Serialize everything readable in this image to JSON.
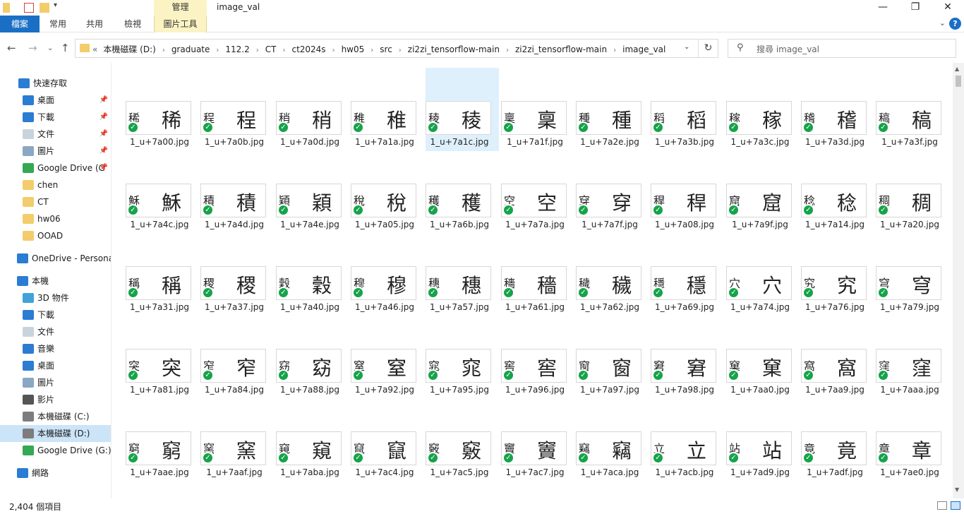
{
  "titlebar": {
    "manage_label": "管理",
    "window_title": "image_val",
    "minimize_icon": "minimize-icon",
    "restore_icon": "restore-icon",
    "close_icon": "close-icon"
  },
  "ribbon": {
    "tabs": [
      "檔案",
      "常用",
      "共用",
      "檢視",
      "圖片工具"
    ],
    "help_label": "?"
  },
  "address": {
    "crumbs": [
      "本機磁碟 (D:)",
      "graduate",
      "112.2",
      "CT",
      "ct2024s",
      "hw05",
      "src",
      "zi2zi_tensorflow-main",
      "zi2zi_tensorflow-main",
      "image_val"
    ]
  },
  "search": {
    "placeholder": "搜尋 image_val"
  },
  "sidebar": {
    "items": [
      {
        "label": "快速存取",
        "icon": "star-icon"
      },
      {
        "label": "桌面",
        "icon": "desktop-icon",
        "pinned": true
      },
      {
        "label": "下載",
        "icon": "download-icon",
        "pinned": true
      },
      {
        "label": "文件",
        "icon": "document-icon",
        "pinned": true
      },
      {
        "label": "圖片",
        "icon": "picture-icon",
        "pinned": true
      },
      {
        "label": "Google Drive (G",
        "icon": "google-drive-icon",
        "pinned": true
      },
      {
        "label": "chen",
        "icon": "folder-icon"
      },
      {
        "label": "CT",
        "icon": "folder-icon"
      },
      {
        "label": "hw06",
        "icon": "folder-icon"
      },
      {
        "label": "OOAD",
        "icon": "folder-icon"
      },
      {
        "label": "OneDrive - Personal",
        "icon": "onedrive-icon"
      },
      {
        "label": "本機",
        "icon": "computer-icon"
      },
      {
        "label": "3D 物件",
        "icon": "cube-icon"
      },
      {
        "label": "下載",
        "icon": "download-icon"
      },
      {
        "label": "文件",
        "icon": "document-icon"
      },
      {
        "label": "音樂",
        "icon": "music-icon"
      },
      {
        "label": "桌面",
        "icon": "desktop-icon"
      },
      {
        "label": "圖片",
        "icon": "picture-icon"
      },
      {
        "label": "影片",
        "icon": "video-icon"
      },
      {
        "label": "本機磁碟 (C:)",
        "icon": "drive-icon"
      },
      {
        "label": "本機磁碟 (D:)",
        "icon": "drive-icon",
        "selected": true
      },
      {
        "label": "Google Drive (G:)",
        "icon": "google-drive-icon"
      },
      {
        "label": "網路",
        "icon": "network-icon"
      }
    ]
  },
  "files": [
    {
      "name": "1_u+7a00.jpg",
      "char": "稀"
    },
    {
      "name": "1_u+7a0b.jpg",
      "char": "程"
    },
    {
      "name": "1_u+7a0d.jpg",
      "char": "稍"
    },
    {
      "name": "1_u+7a1a.jpg",
      "char": "稚"
    },
    {
      "name": "1_u+7a1c.jpg",
      "char": "稜",
      "selected": true
    },
    {
      "name": "1_u+7a1f.jpg",
      "char": "稟"
    },
    {
      "name": "1_u+7a2e.jpg",
      "char": "種"
    },
    {
      "name": "1_u+7a3b.jpg",
      "char": "稻"
    },
    {
      "name": "1_u+7a3c.jpg",
      "char": "稼"
    },
    {
      "name": "1_u+7a3d.jpg",
      "char": "稽"
    },
    {
      "name": "1_u+7a3f.jpg",
      "char": "稿"
    },
    {
      "name": "1_u+7a4c.jpg",
      "char": "穌"
    },
    {
      "name": "1_u+7a4d.jpg",
      "char": "積"
    },
    {
      "name": "1_u+7a4e.jpg",
      "char": "穎"
    },
    {
      "name": "1_u+7a05.jpg",
      "char": "稅"
    },
    {
      "name": "1_u+7a6b.jpg",
      "char": "穫"
    },
    {
      "name": "1_u+7a7a.jpg",
      "char": "空"
    },
    {
      "name": "1_u+7a7f.jpg",
      "char": "穿"
    },
    {
      "name": "1_u+7a08.jpg",
      "char": "稈"
    },
    {
      "name": "1_u+7a9f.jpg",
      "char": "窟"
    },
    {
      "name": "1_u+7a14.jpg",
      "char": "稔"
    },
    {
      "name": "1_u+7a20.jpg",
      "char": "稠"
    },
    {
      "name": "1_u+7a31.jpg",
      "char": "稱"
    },
    {
      "name": "1_u+7a37.jpg",
      "char": "稷"
    },
    {
      "name": "1_u+7a40.jpg",
      "char": "穀"
    },
    {
      "name": "1_u+7a46.jpg",
      "char": "穆"
    },
    {
      "name": "1_u+7a57.jpg",
      "char": "穗"
    },
    {
      "name": "1_u+7a61.jpg",
      "char": "穡"
    },
    {
      "name": "1_u+7a62.jpg",
      "char": "穢"
    },
    {
      "name": "1_u+7a69.jpg",
      "char": "穩"
    },
    {
      "name": "1_u+7a74.jpg",
      "char": "穴"
    },
    {
      "name": "1_u+7a76.jpg",
      "char": "究"
    },
    {
      "name": "1_u+7a79.jpg",
      "char": "穹"
    },
    {
      "name": "1_u+7a81.jpg",
      "char": "突"
    },
    {
      "name": "1_u+7a84.jpg",
      "char": "窄"
    },
    {
      "name": "1_u+7a88.jpg",
      "char": "窈"
    },
    {
      "name": "1_u+7a92.jpg",
      "char": "窒"
    },
    {
      "name": "1_u+7a95.jpg",
      "char": "窕"
    },
    {
      "name": "1_u+7a96.jpg",
      "char": "窖"
    },
    {
      "name": "1_u+7a97.jpg",
      "char": "窗"
    },
    {
      "name": "1_u+7a98.jpg",
      "char": "窘"
    },
    {
      "name": "1_u+7aa0.jpg",
      "char": "窠"
    },
    {
      "name": "1_u+7aa9.jpg",
      "char": "窩"
    },
    {
      "name": "1_u+7aaa.jpg",
      "char": "窪"
    },
    {
      "name": "1_u+7aae.jpg",
      "char": "窮"
    },
    {
      "name": "1_u+7aaf.jpg",
      "char": "窯"
    },
    {
      "name": "1_u+7aba.jpg",
      "char": "窺"
    },
    {
      "name": "1_u+7ac4.jpg",
      "char": "竄"
    },
    {
      "name": "1_u+7ac5.jpg",
      "char": "竅"
    },
    {
      "name": "1_u+7ac7.jpg",
      "char": "竇"
    },
    {
      "name": "1_u+7aca.jpg",
      "char": "竊"
    },
    {
      "name": "1_u+7acb.jpg",
      "char": "立"
    },
    {
      "name": "1_u+7ad9.jpg",
      "char": "站"
    },
    {
      "name": "1_u+7adf.jpg",
      "char": "竟"
    },
    {
      "name": "1_u+7ae0.jpg",
      "char": "章"
    }
  ],
  "status": {
    "count": "2,404 個項目"
  },
  "colors": {
    "accent": "#1a6fc5",
    "picture_tools_tab": "#fbf3c4",
    "sync_ok": "#16a34a",
    "selection": "#cce4f7"
  }
}
